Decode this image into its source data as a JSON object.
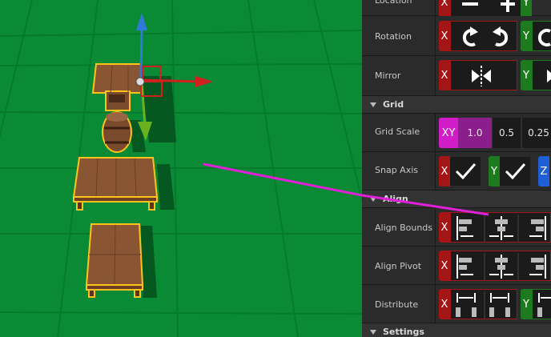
{
  "panel": {
    "rows": {
      "location": "Location",
      "rotation": "Rotation",
      "mirror": "Mirror",
      "grid_scale": "Grid Scale",
      "snap_axis": "Snap Axis",
      "align_bounds": "Align Bounds",
      "align_pivot": "Align Pivot",
      "distribute": "Distribute"
    },
    "sections": {
      "grid": "Grid",
      "align": "Align",
      "settings": "Settings"
    },
    "axes": {
      "x": "X",
      "y": "Y",
      "z": "Z",
      "xy": "XY"
    },
    "grid_scale_values": [
      "1.0",
      "0.5",
      "0.25"
    ],
    "grid_scale_selected": "1.0"
  },
  "colors": {
    "axis_x": "#a41515",
    "axis_y": "#1e7a1e",
    "axis_z": "#1f5fd6",
    "axis_xy": "#d11dc8",
    "viewport_ground": "#0a8a34",
    "selection_outline": "#ffc21a",
    "annotation_line": "#e020d8"
  },
  "icons": {
    "gizmo": "translate-gizmo",
    "rotate_cw": "rotate-cw-icon",
    "rotate_ccw": "rotate-ccw-icon",
    "mirror": "mirror-icon",
    "checkmark": "checkmark-icon",
    "align_left": "align-left-icon",
    "align_center": "align-center-icon",
    "align_right": "align-right-icon",
    "distribute": "distribute-icon"
  }
}
